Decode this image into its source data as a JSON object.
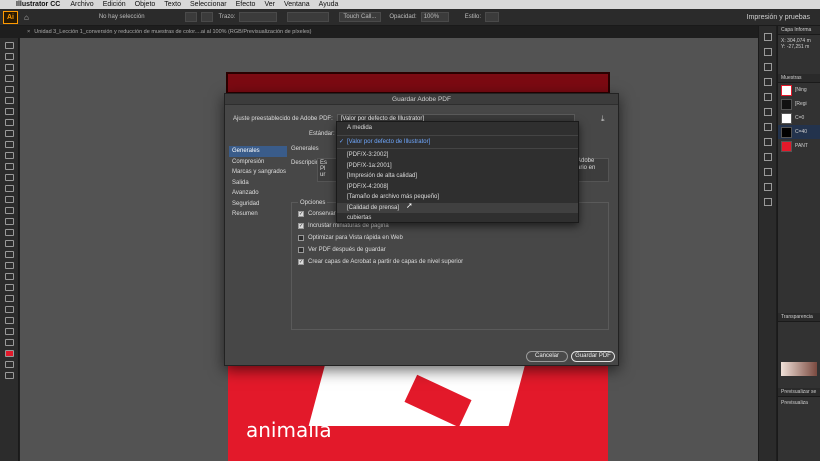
{
  "menubar": {
    "app": "Illustrator CC",
    "items": [
      "Archivo",
      "Edición",
      "Objeto",
      "Texto",
      "Seleccionar",
      "Efecto",
      "Ver",
      "Ventana",
      "Ayuda"
    ]
  },
  "controlbar": {
    "logo": "Ai",
    "selection": "No hay selección",
    "stroke_label": "Trazo:",
    "brush": "Touch Call...",
    "opacity_label": "Opacidad:",
    "opacity_value": "100%",
    "style_label": "Estilo:",
    "workspace": "Impresión y pruebas"
  },
  "document_tab": "Unidad 3_Lección 1_conversión y reducción de muestras de color....ai al 100% (RGB/Previsualización de píxeles)",
  "artwork": {
    "brand_text": "animalia",
    "colors": {
      "red": "#e3192a",
      "dark_red": "#7c0a12"
    }
  },
  "panels": {
    "info": {
      "title": "Capa",
      "tab2": "Informa",
      "x": "X: 304,074 m",
      "y": "Y: -27,251 m"
    },
    "swatches": {
      "title": "Muestras",
      "rows": [
        "[Ning",
        "[Regi",
        "C=0",
        "C=40",
        "PANT"
      ]
    },
    "transparency": {
      "title": "Transparencia"
    },
    "preview": {
      "title": "Previsualizar se",
      "option": "Previsualiza"
    }
  },
  "dialog": {
    "title": "Guardar Adobe PDF",
    "preset_label": "Ajuste preestablecido de Adobe PDF:",
    "preset_value": "[Valor por defecto de Illustrator]",
    "standard_label": "Estándar:",
    "nav": [
      "Generales",
      "Compresión",
      "Marcas y sangrados",
      "Salida",
      "Avanzado",
      "Seguridad",
      "Resumen"
    ],
    "section": "Generales",
    "description_label": "Descripción:",
    "description_start": "Es",
    "description_line2": "Pl",
    "description_line3": "ur",
    "description_right1": "Adobe",
    "description_right2": "ario en",
    "options_title": "Opciones",
    "options": [
      {
        "label": "Conservar c",
        "checked": true
      },
      {
        "label": "Incrustar miniaturas de página",
        "checked": true
      },
      {
        "label": "Optimizar para Vista rápida en Web",
        "checked": false
      },
      {
        "label": "Ver PDF después de guardar",
        "checked": false
      },
      {
        "label": "Crear capas de Acrobat a partir de capas de nivel superior",
        "checked": true
      }
    ],
    "cancel": "Cancelar",
    "save": "Guardar PDF"
  },
  "dropdown": {
    "items": [
      "A medida",
      "[Valor por defecto de Illustrator]",
      "[PDF/X-3:2002]",
      "[PDF/X-1a:2001]",
      "[Impresión de alta calidad]",
      "[PDF/X-4:2008]",
      "[Tamaño de archivo más pequeño]",
      "[Calidad de prensa]",
      "cubiertas"
    ]
  }
}
